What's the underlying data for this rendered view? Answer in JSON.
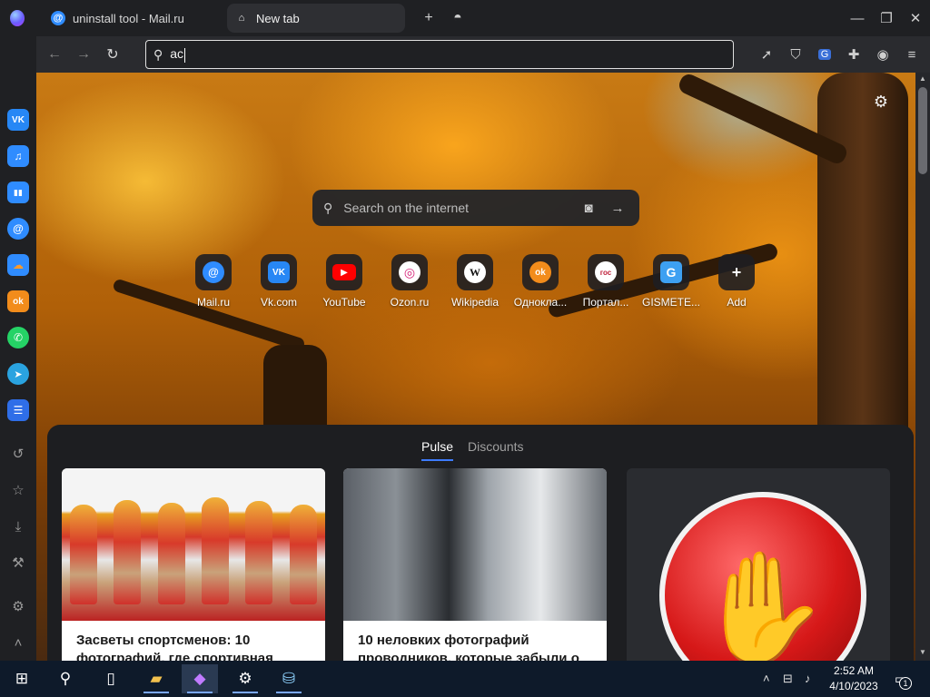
{
  "tabs": [
    {
      "label": "uninstall tool - Mail.ru",
      "icon": "mail-ru-icon"
    },
    {
      "label": "New tab",
      "icon": "home-icon"
    }
  ],
  "address_bar": {
    "value": "ac"
  },
  "sidebar": {
    "apps": [
      {
        "name": "vk",
        "glyph": "VK",
        "color": "#2787f5"
      },
      {
        "name": "music",
        "glyph": "♫",
        "color": "#2f8cff"
      },
      {
        "name": "stats",
        "glyph": "▮▮",
        "color": "#2f8cff"
      },
      {
        "name": "mail",
        "glyph": "@",
        "color": "#2f8cff"
      },
      {
        "name": "cloud",
        "glyph": "☁",
        "color": "#ff7b00"
      },
      {
        "name": "ok",
        "glyph": "ok",
        "color": "#f28c1b"
      },
      {
        "name": "whatsapp",
        "glyph": "✆",
        "color": "#25d366"
      },
      {
        "name": "telegram",
        "glyph": "➤",
        "color": "#2aa3e0"
      },
      {
        "name": "tasks",
        "glyph": "☰",
        "color": "#2f6ee8"
      }
    ]
  },
  "search": {
    "placeholder": "Search on the internet"
  },
  "tiles": [
    {
      "label": "Mail.ru",
      "glyph": "@",
      "color": "#2f8cff"
    },
    {
      "label": "Vk.com",
      "glyph": "VK",
      "color": "#2787f5"
    },
    {
      "label": "YouTube",
      "glyph": "▶",
      "color": "#ff0000"
    },
    {
      "label": "Ozon.ru",
      "glyph": "◎",
      "color": "#d8247a"
    },
    {
      "label": "Wikipedia",
      "glyph": "W",
      "color": "#ffffff"
    },
    {
      "label": "Однокла...",
      "glyph": "ok",
      "color": "#f28c1b"
    },
    {
      "label": "Портал...",
      "glyph": "гос",
      "color": "#e6e6e6"
    },
    {
      "label": "GISMETE...",
      "glyph": "G",
      "color": "#3da0f2"
    },
    {
      "label": "Add",
      "glyph": "+",
      "color": "transparent"
    }
  ],
  "feed": {
    "tabs": [
      {
        "label": "Pulse",
        "active": true
      },
      {
        "label": "Discounts",
        "active": false
      }
    ],
    "cards": [
      {
        "title": "Засветы спортсменов: 10 фотографий, где спортивная"
      },
      {
        "title": "10 неловких фотографий проводников, которые забыли о"
      }
    ]
  },
  "taskbar": {
    "time": "2:52 AM",
    "date": "4/10/2023",
    "notifications": "1"
  }
}
